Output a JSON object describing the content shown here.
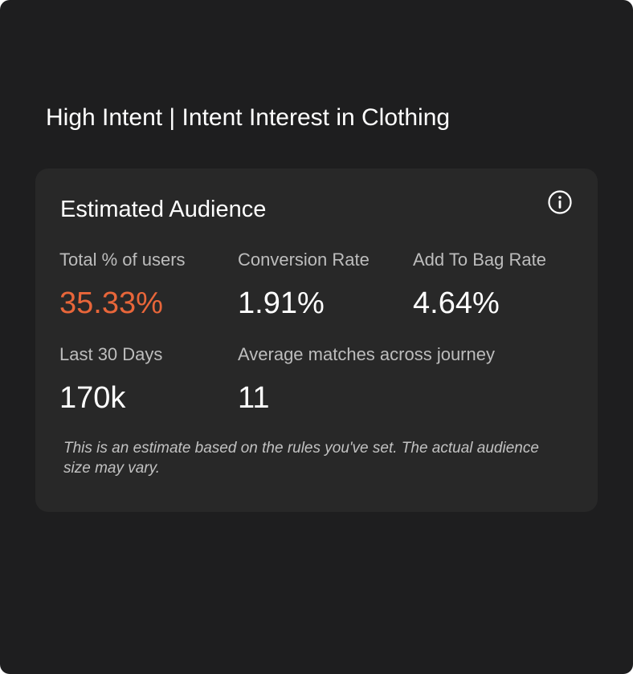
{
  "segment": {
    "title": "High Intent | Intent Interest in Clothing"
  },
  "card": {
    "title": "Estimated Audience",
    "info_icon": "info-circle-icon",
    "metrics": [
      {
        "label": "Total % of users",
        "value": "35.33%"
      },
      {
        "label": "Conversion Rate",
        "value": "1.91%"
      },
      {
        "label": "Add To Bag Rate",
        "value": "4.64%"
      },
      {
        "label": "Last 30 Days",
        "value": "170k"
      },
      {
        "label": "Average matches across journey",
        "value": "11"
      }
    ],
    "disclaimer": "This is an estimate based on the rules you've set. The actual audience size may vary."
  },
  "colors": {
    "panel_background": "#1e1e1f",
    "card_background": "#282828",
    "accent": "#e8663a",
    "text_primary": "#ffffff",
    "text_secondary": "#bdbdbd"
  }
}
